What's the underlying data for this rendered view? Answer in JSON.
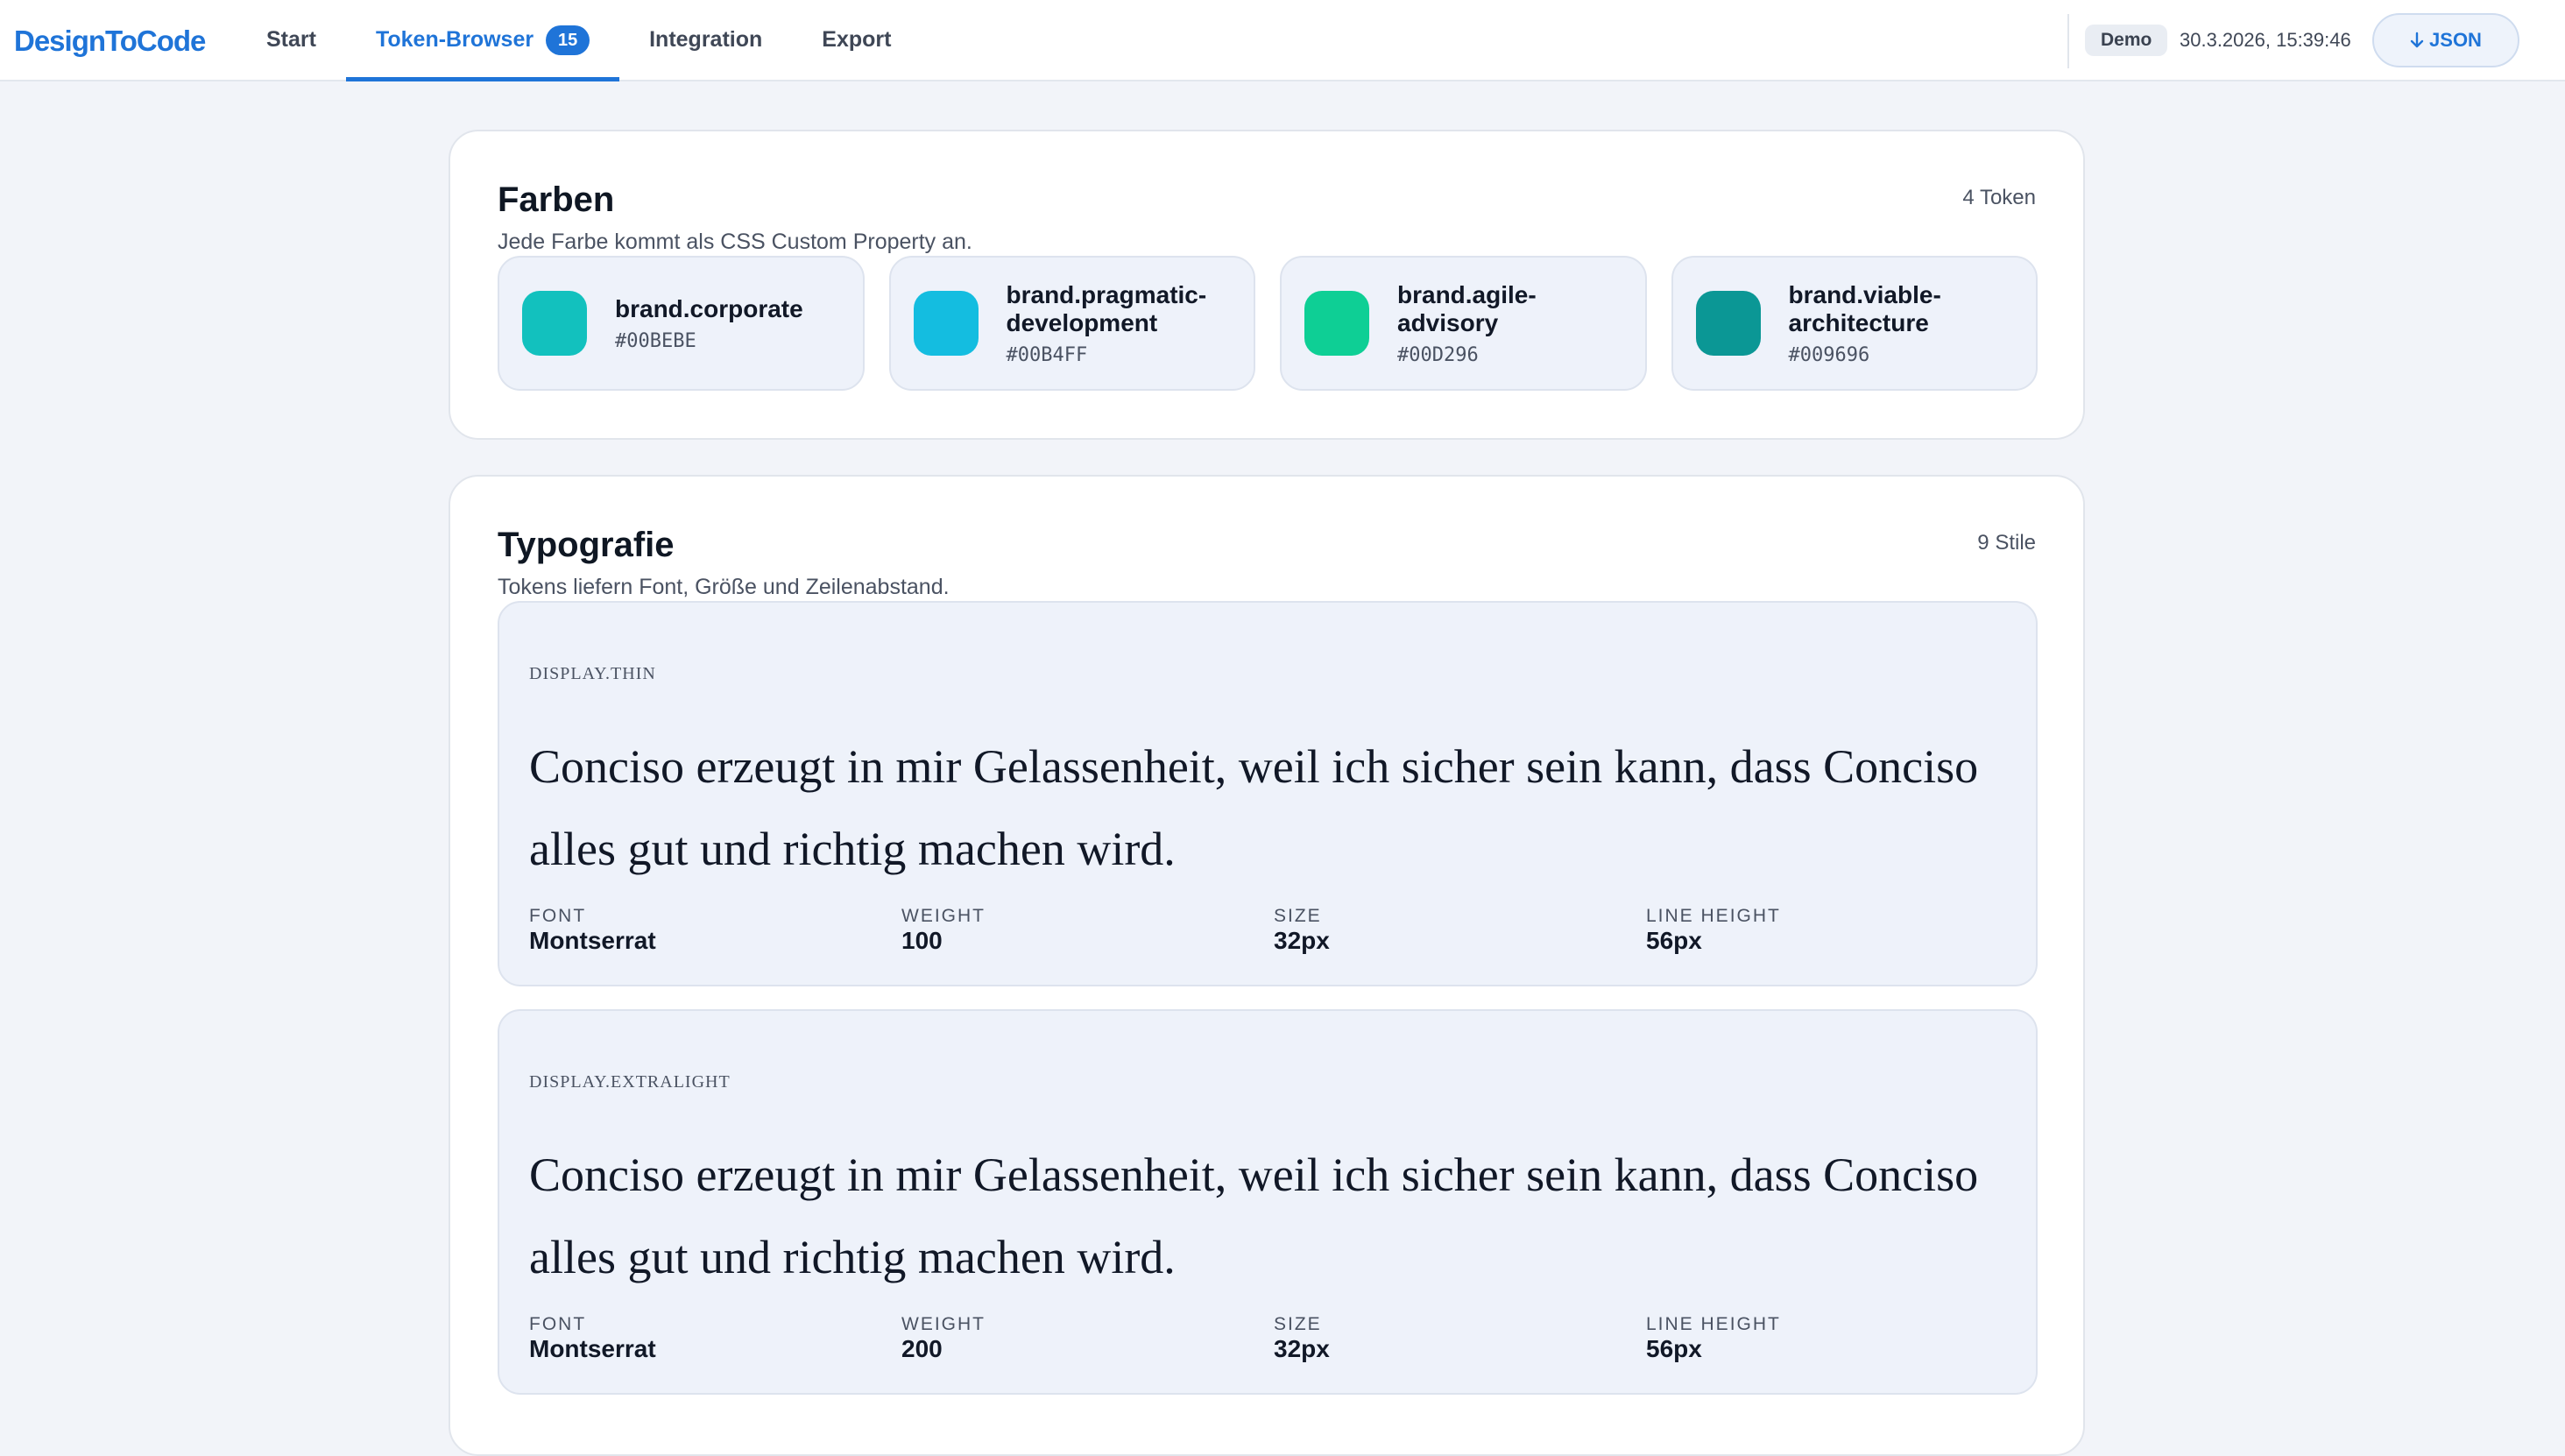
{
  "app": {
    "logo": "DesignToCode"
  },
  "nav": {
    "items": [
      {
        "label": "Start"
      },
      {
        "label": "Token-Browser",
        "badge": "15"
      },
      {
        "label": "Integration"
      },
      {
        "label": "Export"
      }
    ],
    "active_index": 1
  },
  "header_right": {
    "mode_badge": "Demo",
    "timestamp": "30.3.2026, 15:39:46",
    "download_icon": "arrow-down-icon",
    "download_label": "JSON"
  },
  "colors_section": {
    "title": "Farben",
    "subtitle": "Jede Farbe kommt als CSS Custom Property an.",
    "count": "4 Token",
    "swatches": [
      {
        "name": "brand.corporate",
        "hex": "#00BEBE",
        "color": "#12c1be"
      },
      {
        "name": "brand.pragmatic-development",
        "hex": "#00B4FF",
        "color": "#14bde0"
      },
      {
        "name": "brand.agile-advisory",
        "hex": "#00D296",
        "color": "#0ecf95"
      },
      {
        "name": "brand.viable-architecture",
        "hex": "#009696",
        "color": "#0b9795"
      }
    ]
  },
  "typography_section": {
    "title": "Typografie",
    "subtitle": "Tokens liefern Font, Größe und Zeilenabstand.",
    "count": "9 Stile",
    "meta_labels": {
      "font": "FONT",
      "weight": "WEIGHT",
      "size": "SIZE",
      "line_height": "LINE HEIGHT"
    },
    "styles": [
      {
        "token": "DISPLAY.THIN",
        "sample": "Conciso erzeugt in mir Gelassenheit, weil ich sicher sein kann, dass Conciso alles gut und richtig machen wird.",
        "font": "Montserrat",
        "weight": "100",
        "size": "32px",
        "line_height": "56px"
      },
      {
        "token": "DISPLAY.EXTRALIGHT",
        "sample": "Conciso erzeugt in mir Gelassenheit, weil ich sicher sein kann, dass Conciso alles gut und richtig machen wird.",
        "font": "Montserrat",
        "weight": "200",
        "size": "32px",
        "line_height": "56px"
      }
    ]
  }
}
